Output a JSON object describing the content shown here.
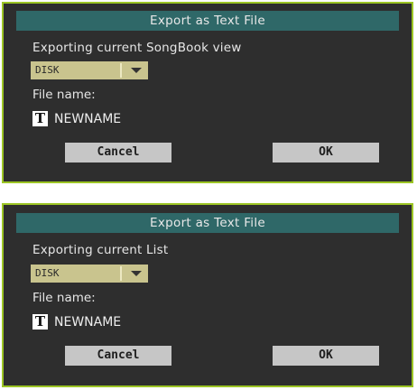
{
  "dialogs": [
    {
      "title": "Export as Text File",
      "message": "Exporting current SongBook view",
      "device": "DISK",
      "file_label": "File name:",
      "text_icon": "T",
      "file_name": "NEWNAME",
      "cancel_label": "Cancel",
      "ok_label": "OK"
    },
    {
      "title": "Export as Text File",
      "message": "Exporting current List",
      "device": "DISK",
      "file_label": "File name:",
      "text_icon": "T",
      "file_name": "NEWNAME",
      "cancel_label": "Cancel",
      "ok_label": "OK"
    }
  ],
  "colors": {
    "dialog_bg": "#2e2e2e",
    "dialog_border": "#9cc524",
    "title_bar": "#2f6868",
    "dropdown_bg": "#c9c48e",
    "button_bg": "#c6c6c6",
    "text": "#e6e6e6"
  },
  "icons": {
    "dropdown_arrow": "chevron-down-icon",
    "text_edit": "text-edit-icon"
  }
}
